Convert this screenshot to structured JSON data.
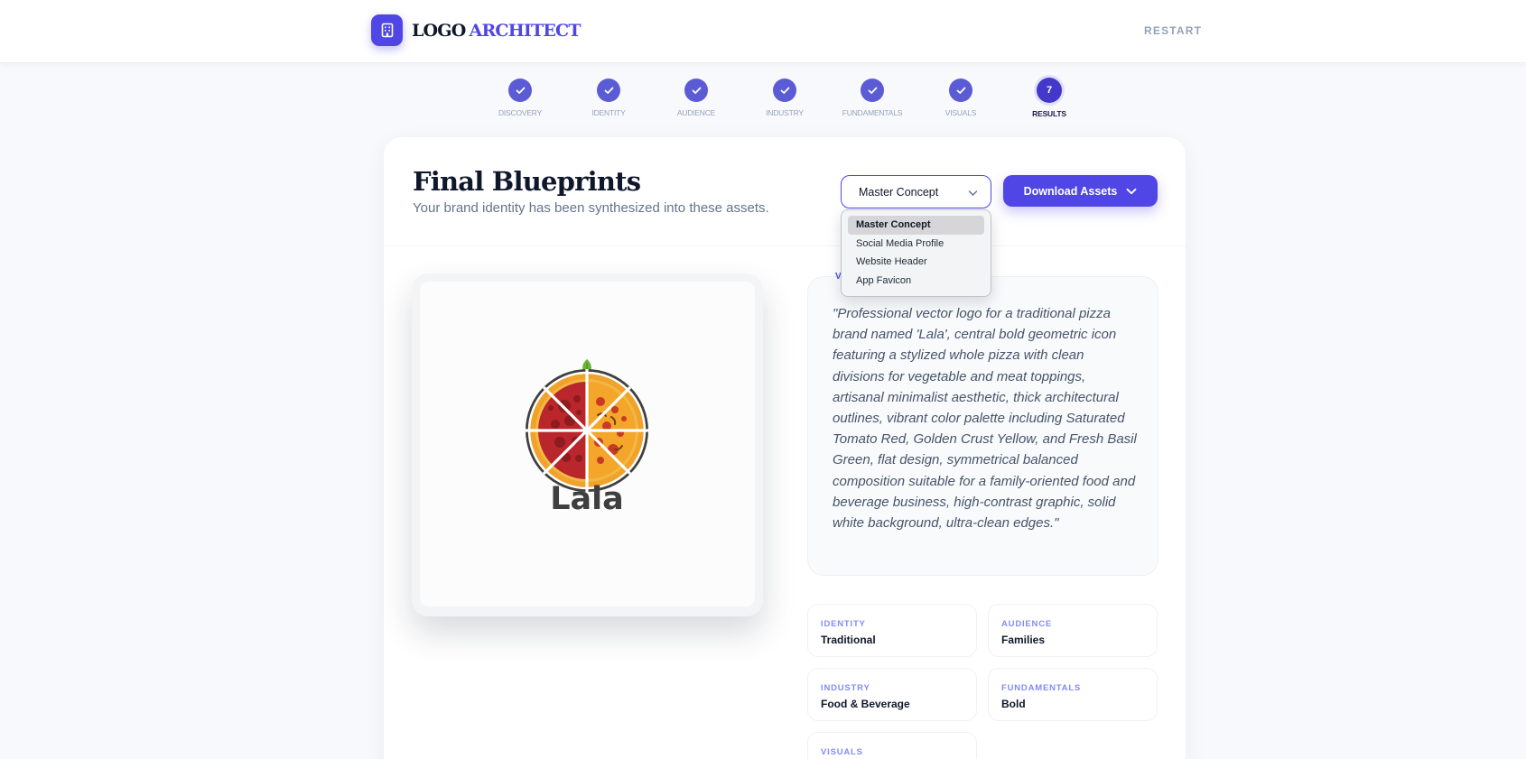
{
  "app": {
    "logo_word1": "LOGO",
    "logo_word2": "ARCHITECT",
    "restart_label": "RESTART"
  },
  "colors": {
    "accent": "#4f46e5",
    "step_done": "#5b5bd6",
    "pizza_red": "#c0282a",
    "crust_yellow": "#f5a623",
    "basil_green": "#6bb33a"
  },
  "icons": {
    "brand": "building-icon",
    "step_done": "check-icon",
    "dropdown": "chevron-down-icon"
  },
  "steps": [
    {
      "label": "DISCOVERY",
      "state": "done"
    },
    {
      "label": "IDENTITY",
      "state": "done"
    },
    {
      "label": "AUDIENCE",
      "state": "done"
    },
    {
      "label": "INDUSTRY",
      "state": "done"
    },
    {
      "label": "FUNDAMENTALS",
      "state": "done"
    },
    {
      "label": "VISUALS",
      "state": "done"
    },
    {
      "label": "RESULTS",
      "state": "active",
      "number": "7"
    }
  ],
  "main": {
    "title": "Final Blueprints",
    "subtitle": "Your brand identity has been synthesized into these assets.",
    "variant_select": {
      "selected": "Master Concept",
      "options": [
        "Master Concept",
        "Social Media Profile",
        "Website Header",
        "App Favicon"
      ]
    },
    "download_label": "Download Assets",
    "preview": {
      "brand_name": "Lala"
    },
    "prompt": {
      "label": "V",
      "text": "\"Professional vector logo for a traditional pizza brand named 'Lala', central bold geometric icon featuring a stylized whole pizza with clean divisions for vegetable and meat toppings, artisanal minimalist aesthetic, thick architectural outlines, vibrant color palette including Saturated Tomato Red, Golden Crust Yellow, and Fresh Basil Green, flat design, symmetrical balanced composition suitable for a family-oriented food and beverage business, high-contrast graphic, solid white background, ultra-clean edges.\""
    },
    "tags": [
      {
        "key": "IDENTITY",
        "value": "Traditional"
      },
      {
        "key": "AUDIENCE",
        "value": "Families"
      },
      {
        "key": "INDUSTRY",
        "value": "Food & Beverage"
      },
      {
        "key": "FUNDAMENTALS",
        "value": "Bold"
      },
      {
        "key": "VISUALS",
        "value": ""
      }
    ]
  }
}
